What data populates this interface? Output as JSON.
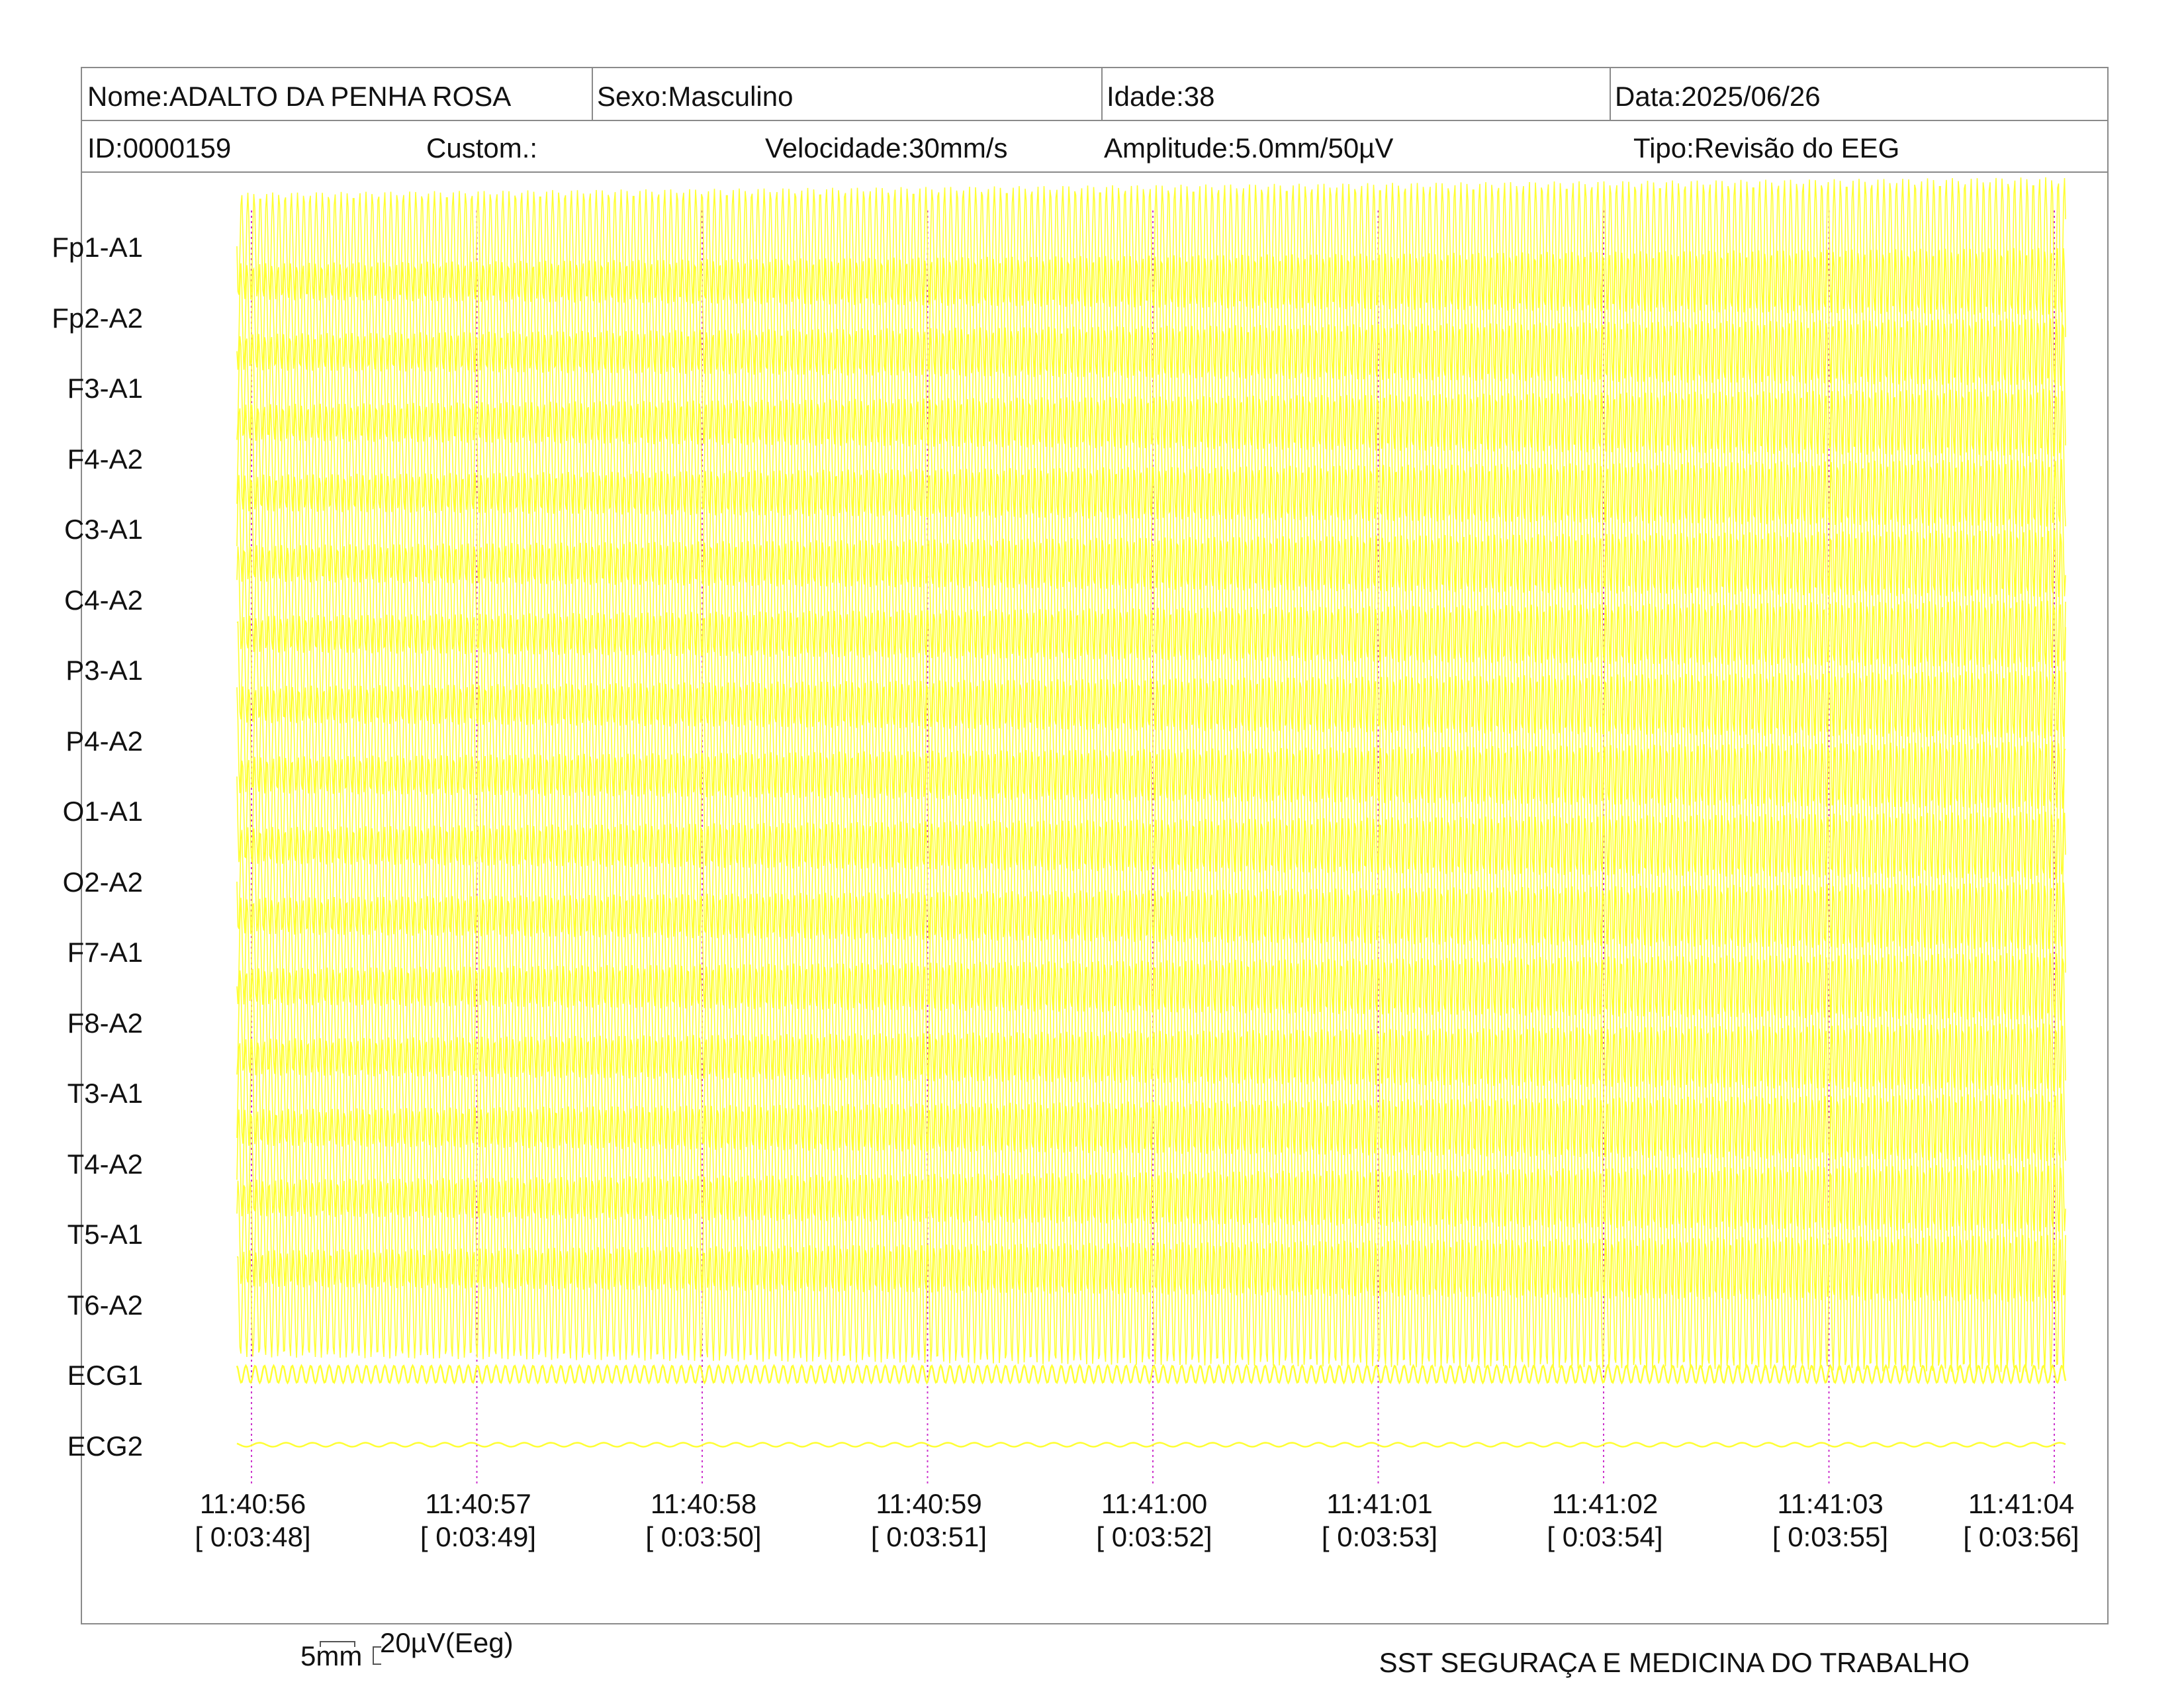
{
  "header": {
    "nome": "Nome:ADALTO DA PENHA ROSA",
    "sexo": "Sexo:Masculino",
    "idade": "Idade:38",
    "data": "Data:2025/06/26",
    "id": "ID:0000159",
    "custom": "Custom.:",
    "velocidade": "Velocidade:30mm/s",
    "amplitude": "Amplitude:5.0mm/50µV",
    "tipo": "Tipo:Revisão do EEG"
  },
  "channels": [
    "Fp1-A1",
    "Fp2-A2",
    "F3-A1",
    "F4-A2",
    "C3-A1",
    "C4-A2",
    "P3-A1",
    "P4-A2",
    "O1-A1",
    "O2-A2",
    "F7-A1",
    "F8-A2",
    "T3-A1",
    "T4-A2",
    "T5-A1",
    "T6-A2",
    "ECG1",
    "ECG2"
  ],
  "time_ticks": [
    {
      "clock": "11:40:56",
      "elapsed": "[ 0:03:48]"
    },
    {
      "clock": "11:40:57",
      "elapsed": "[ 0:03:49]"
    },
    {
      "clock": "11:40:58",
      "elapsed": "[ 0:03:50]"
    },
    {
      "clock": "11:40:59",
      "elapsed": "[ 0:03:51]"
    },
    {
      "clock": "11:41:00",
      "elapsed": "[ 0:03:52]"
    },
    {
      "clock": "11:41:01",
      "elapsed": "[ 0:03:53]"
    },
    {
      "clock": "11:41:02",
      "elapsed": "[ 0:03:54]"
    },
    {
      "clock": "11:41:03",
      "elapsed": "[ 0:03:55]"
    },
    {
      "clock": "11:41:04",
      "elapsed": "[ 0:03:56]"
    }
  ],
  "scale": {
    "length": "5mm",
    "amplitude": "20µV(Eeg)"
  },
  "footer": "SST SEGURAÇA E MEDICINA DO TRABALHO",
  "colors": {
    "trace": "#ffff33",
    "second_marker": "#cc33cc",
    "border": "#8a8a8a"
  }
}
